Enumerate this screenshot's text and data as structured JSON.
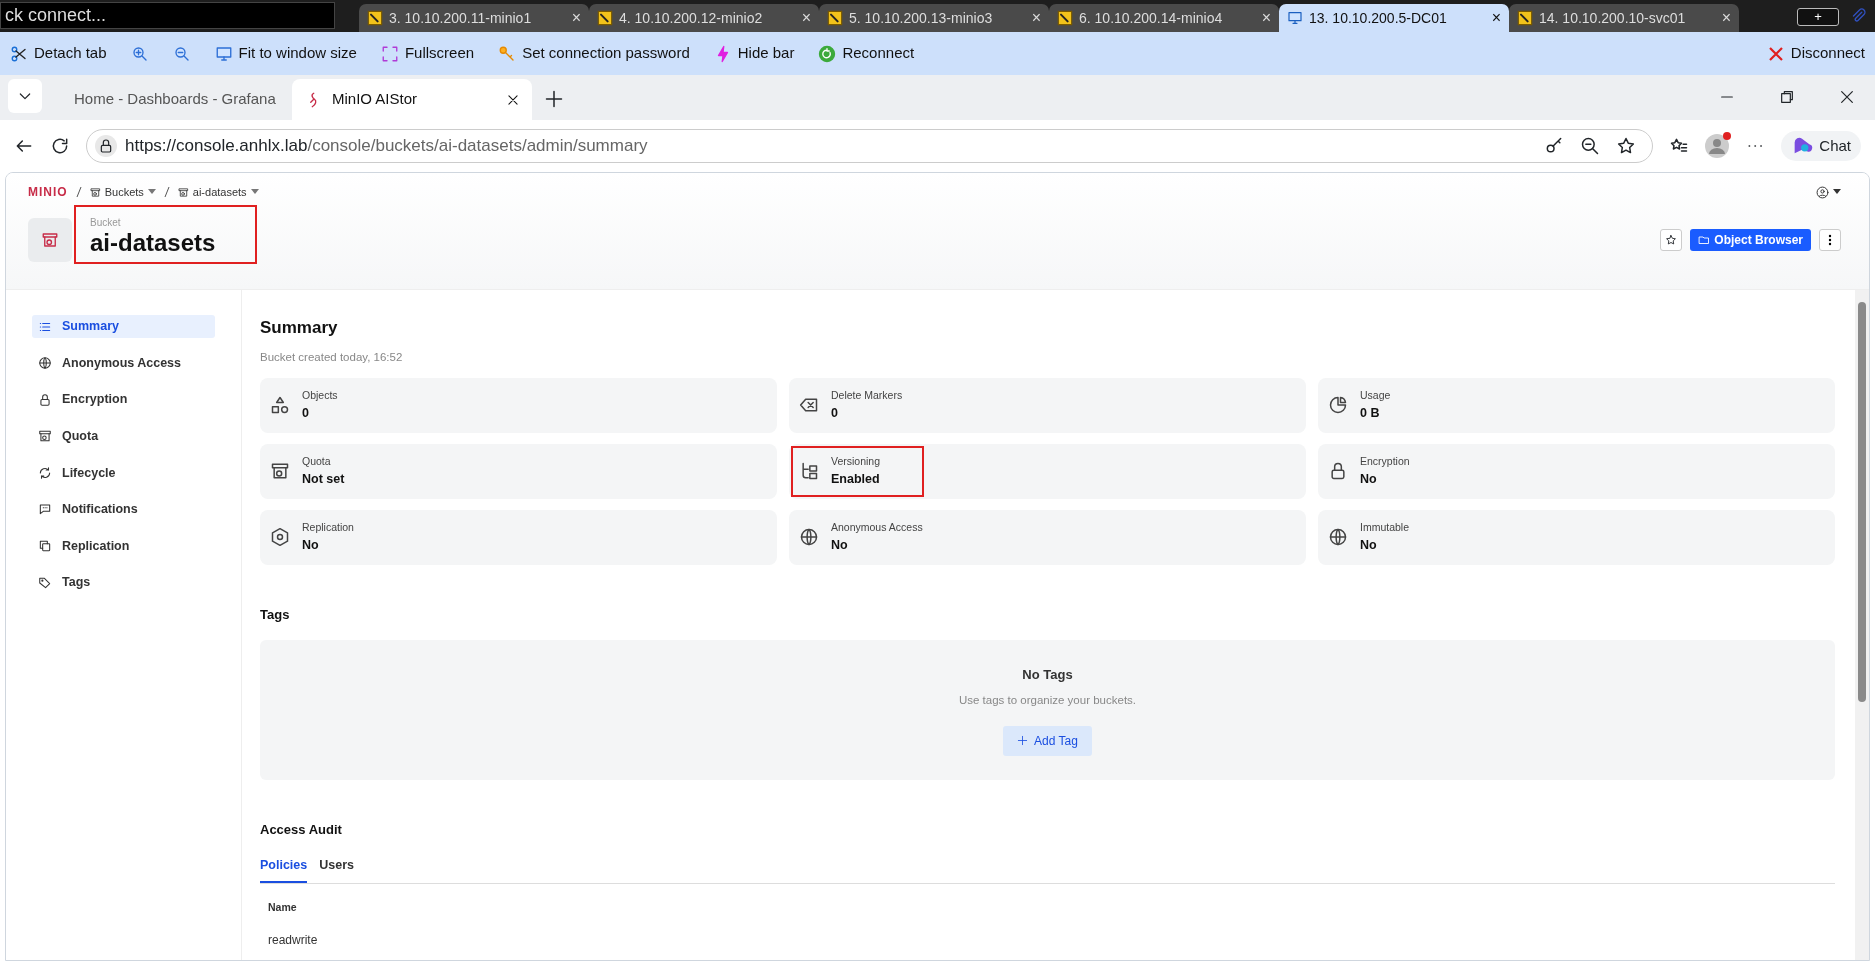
{
  "remote_bar": {
    "quick_connect": "ck connect...",
    "tabs": [
      {
        "label": "3. 10.10.200.11-minio1",
        "kind": "ssh",
        "selected": false,
        "close": "×"
      },
      {
        "label": "4. 10.10.200.12-minio2",
        "kind": "ssh",
        "selected": false,
        "close": "×"
      },
      {
        "label": "5. 10.10.200.13-minio3",
        "kind": "ssh",
        "selected": false,
        "close": "×"
      },
      {
        "label": "6. 10.10.200.14-minio4",
        "kind": "ssh",
        "selected": false,
        "close": "×"
      },
      {
        "label": "13. 10.10.200.5-DC01",
        "kind": "rdp",
        "selected": true,
        "close": "×"
      },
      {
        "label": "14. 10.10.200.10-svc01",
        "kind": "ssh",
        "selected": false,
        "close": "×"
      }
    ],
    "new_tab": "+"
  },
  "remote_toolbar": {
    "items": [
      {
        "kind": "scissors",
        "label": "Detach tab"
      },
      {
        "kind": "zoom-in"
      },
      {
        "kind": "zoom-out"
      },
      {
        "kind": "monitor",
        "label": "Fit to window size"
      },
      {
        "kind": "fullscreen",
        "label": "Fullscreen"
      },
      {
        "kind": "key",
        "label": "Set connection password"
      },
      {
        "kind": "bolt",
        "label": "Hide bar"
      },
      {
        "kind": "reconnect",
        "label": "Reconnect"
      }
    ],
    "disconnect": "Disconnect"
  },
  "browser": {
    "tabs": [
      {
        "label": "Home - Dashboards - Grafana",
        "kind": "grafana",
        "selected": false
      },
      {
        "label": "MinIO AIStor",
        "kind": "minio",
        "selected": true
      }
    ],
    "url_host": "https://console.anhlx.lab",
    "url_path": "/console/buckets/ai-datasets/admin/summary",
    "chat": "Chat"
  },
  "app": {
    "logo": "MINIO",
    "breadcrumb": [
      "Buckets",
      "ai-datasets"
    ],
    "bucket": {
      "label": "Bucket",
      "name": "ai-datasets",
      "highlighted": true
    },
    "object_browser": "Object Browser",
    "sidebar": {
      "items": [
        {
          "label": "Summary",
          "kind": "list",
          "selected": true
        },
        {
          "label": "Anonymous Access",
          "kind": "globe",
          "selected": false
        },
        {
          "label": "Encryption",
          "kind": "lock",
          "selected": false
        },
        {
          "label": "Quota",
          "kind": "archive",
          "selected": false
        },
        {
          "label": "Lifecycle",
          "kind": "cycle",
          "selected": false
        },
        {
          "label": "Notifications",
          "kind": "chat",
          "selected": false
        },
        {
          "label": "Replication",
          "kind": "copy",
          "selected": false
        },
        {
          "label": "Tags",
          "kind": "tag",
          "selected": false
        }
      ]
    },
    "summary": {
      "title": "Summary",
      "subtitle": "Bucket created today, 16:52",
      "cards": [
        {
          "label": "Objects",
          "value": "0",
          "kind": "shapes",
          "highlighted": false
        },
        {
          "label": "Delete Markers",
          "value": "0",
          "kind": "backspace",
          "highlighted": false
        },
        {
          "label": "Usage",
          "value": "0 B",
          "kind": "pie",
          "highlighted": false
        },
        {
          "label": "Quota",
          "value": "Not set",
          "kind": "archive",
          "highlighted": false
        },
        {
          "label": "Versioning",
          "value": "Enabled",
          "kind": "branch",
          "highlighted": true
        },
        {
          "label": "Encryption",
          "value": "No",
          "kind": "lock",
          "highlighted": false
        },
        {
          "label": "Replication",
          "value": "No",
          "kind": "hexagon",
          "highlighted": false
        },
        {
          "label": "Anonymous Access",
          "value": "No",
          "kind": "globe",
          "highlighted": false
        },
        {
          "label": "Immutable",
          "value": "No",
          "kind": "globe",
          "highlighted": false
        }
      ]
    },
    "tags": {
      "title": "Tags",
      "empty_title": "No Tags",
      "empty_text": "Use tags to organize your buckets.",
      "add_button": "Add Tag"
    },
    "access_audit": {
      "title": "Access Audit",
      "tabs": [
        {
          "label": "Policies",
          "selected": true
        },
        {
          "label": "Users",
          "selected": false
        }
      ],
      "columns": [
        "Name"
      ],
      "rows": [
        [
          "readwrite"
        ]
      ]
    }
  }
}
